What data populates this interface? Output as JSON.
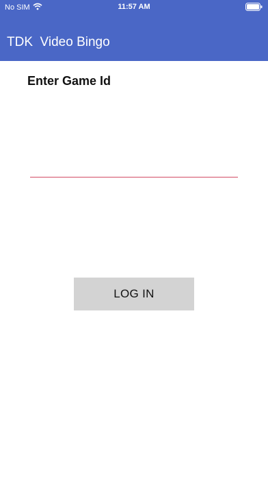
{
  "status_bar": {
    "carrier": "No SIM",
    "time": "11:57 AM",
    "wifi_icon": "wifi-icon",
    "battery_icon": "battery-icon"
  },
  "app_bar": {
    "title": "TDK  Video Bingo",
    "background_color": "#4a67c6"
  },
  "form": {
    "label": "Enter Game Id",
    "input_value": "",
    "underline_color": "#d24b63",
    "login_label": "LOG IN"
  }
}
